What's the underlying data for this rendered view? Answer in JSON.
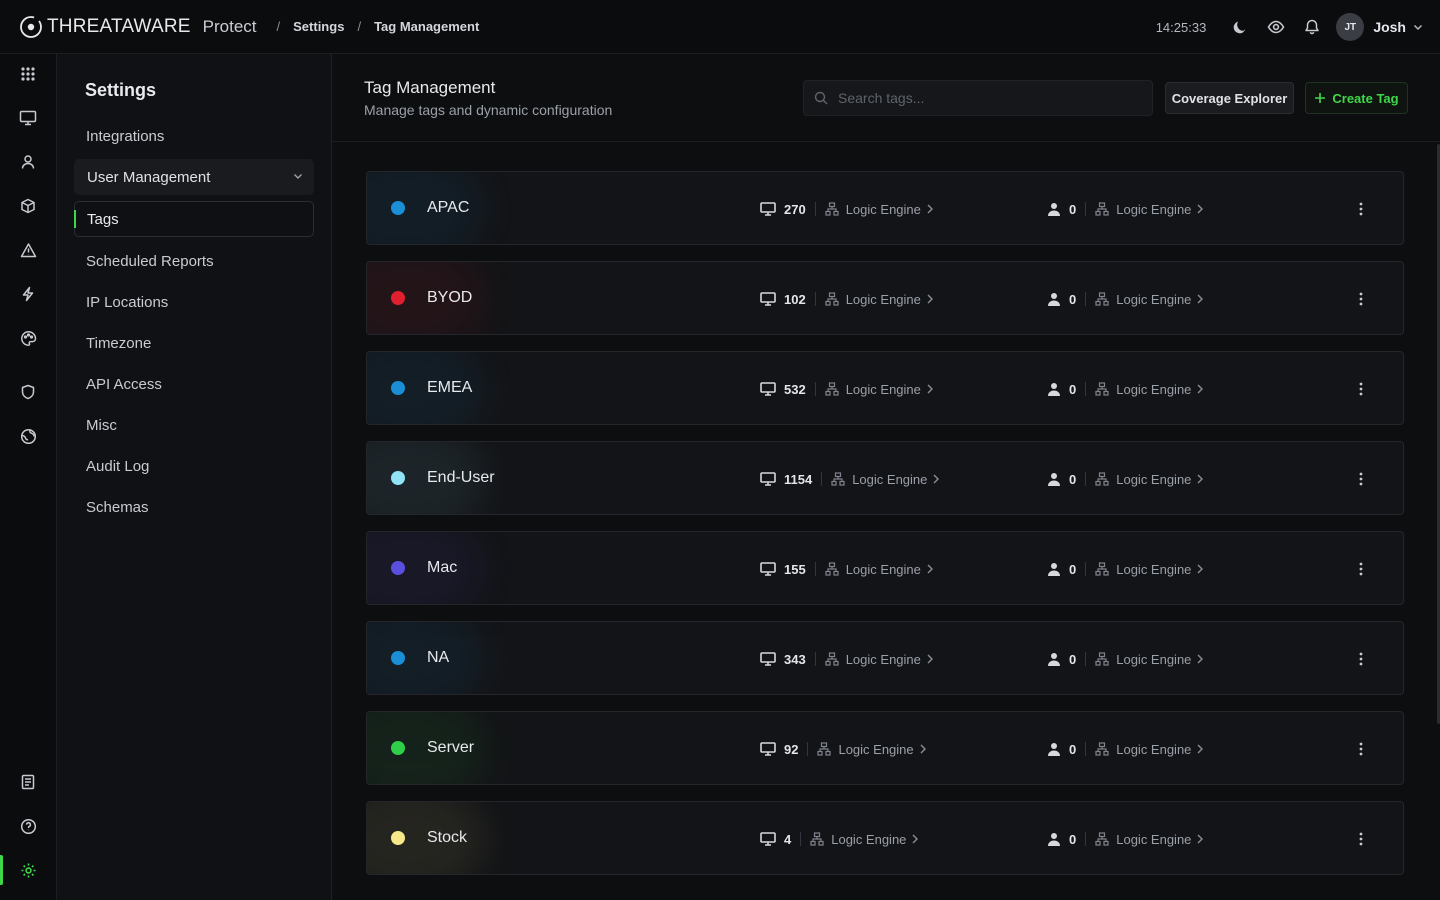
{
  "topbar": {
    "brand_threat": "THREAT",
    "brand_aware": "AWARE",
    "product": "Protect",
    "breadcrumb": [
      "Settings",
      "Tag Management"
    ],
    "separator": "/",
    "clock": "14:25:33",
    "user_initials": "JT",
    "user_name": "Josh"
  },
  "rail": {
    "items": [
      "grid-icon",
      "monitor-icon",
      "user-icon",
      "box-icon",
      "alert-icon",
      "bolt-icon",
      "palette-icon",
      "shield-icon",
      "globe-icon"
    ],
    "bottom": [
      "docs-icon",
      "help-icon",
      "settings-icon"
    ],
    "active": "settings-icon"
  },
  "settings": {
    "title": "Settings",
    "items": [
      {
        "label": "Integrations"
      },
      {
        "label": "User Management"
      },
      {
        "label": "Tags"
      },
      {
        "label": "Scheduled Reports"
      },
      {
        "label": "IP Locations"
      },
      {
        "label": "Timezone"
      },
      {
        "label": "API Access"
      },
      {
        "label": "Misc"
      },
      {
        "label": "Audit Log"
      },
      {
        "label": "Schemas"
      }
    ],
    "active": "Tags"
  },
  "page": {
    "title": "Tag Management",
    "subtitle": "Manage tags and dynamic configuration",
    "search_placeholder": "Search tags...",
    "coverage_button": "Coverage Explorer",
    "create_button": "Create Tag"
  },
  "tags": [
    {
      "name": "APAC",
      "color": "#1a8fd6",
      "devices": "270",
      "device_engine": "Logic Engine",
      "users": "0",
      "user_engine": "Logic Engine"
    },
    {
      "name": "BYOD",
      "color": "#e0202e",
      "devices": "102",
      "device_engine": "Logic Engine",
      "users": "0",
      "user_engine": "Logic Engine"
    },
    {
      "name": "EMEA",
      "color": "#1a8fd6",
      "devices": "532",
      "device_engine": "Logic Engine",
      "users": "0",
      "user_engine": "Logic Engine"
    },
    {
      "name": "End-User",
      "color": "#8fe3f5",
      "devices": "1154",
      "device_engine": "Logic Engine",
      "users": "0",
      "user_engine": "Logic Engine"
    },
    {
      "name": "Mac",
      "color": "#5b4fe0",
      "devices": "155",
      "device_engine": "Logic Engine",
      "users": "0",
      "user_engine": "Logic Engine"
    },
    {
      "name": "NA",
      "color": "#1a8fd6",
      "devices": "343",
      "device_engine": "Logic Engine",
      "users": "0",
      "user_engine": "Logic Engine"
    },
    {
      "name": "Server",
      "color": "#2fcf4a",
      "devices": "92",
      "device_engine": "Logic Engine",
      "users": "0",
      "user_engine": "Logic Engine"
    },
    {
      "name": "Stock",
      "color": "#f7e98a",
      "devices": "4",
      "device_engine": "Logic Engine",
      "users": "0",
      "user_engine": "Logic Engine"
    }
  ]
}
